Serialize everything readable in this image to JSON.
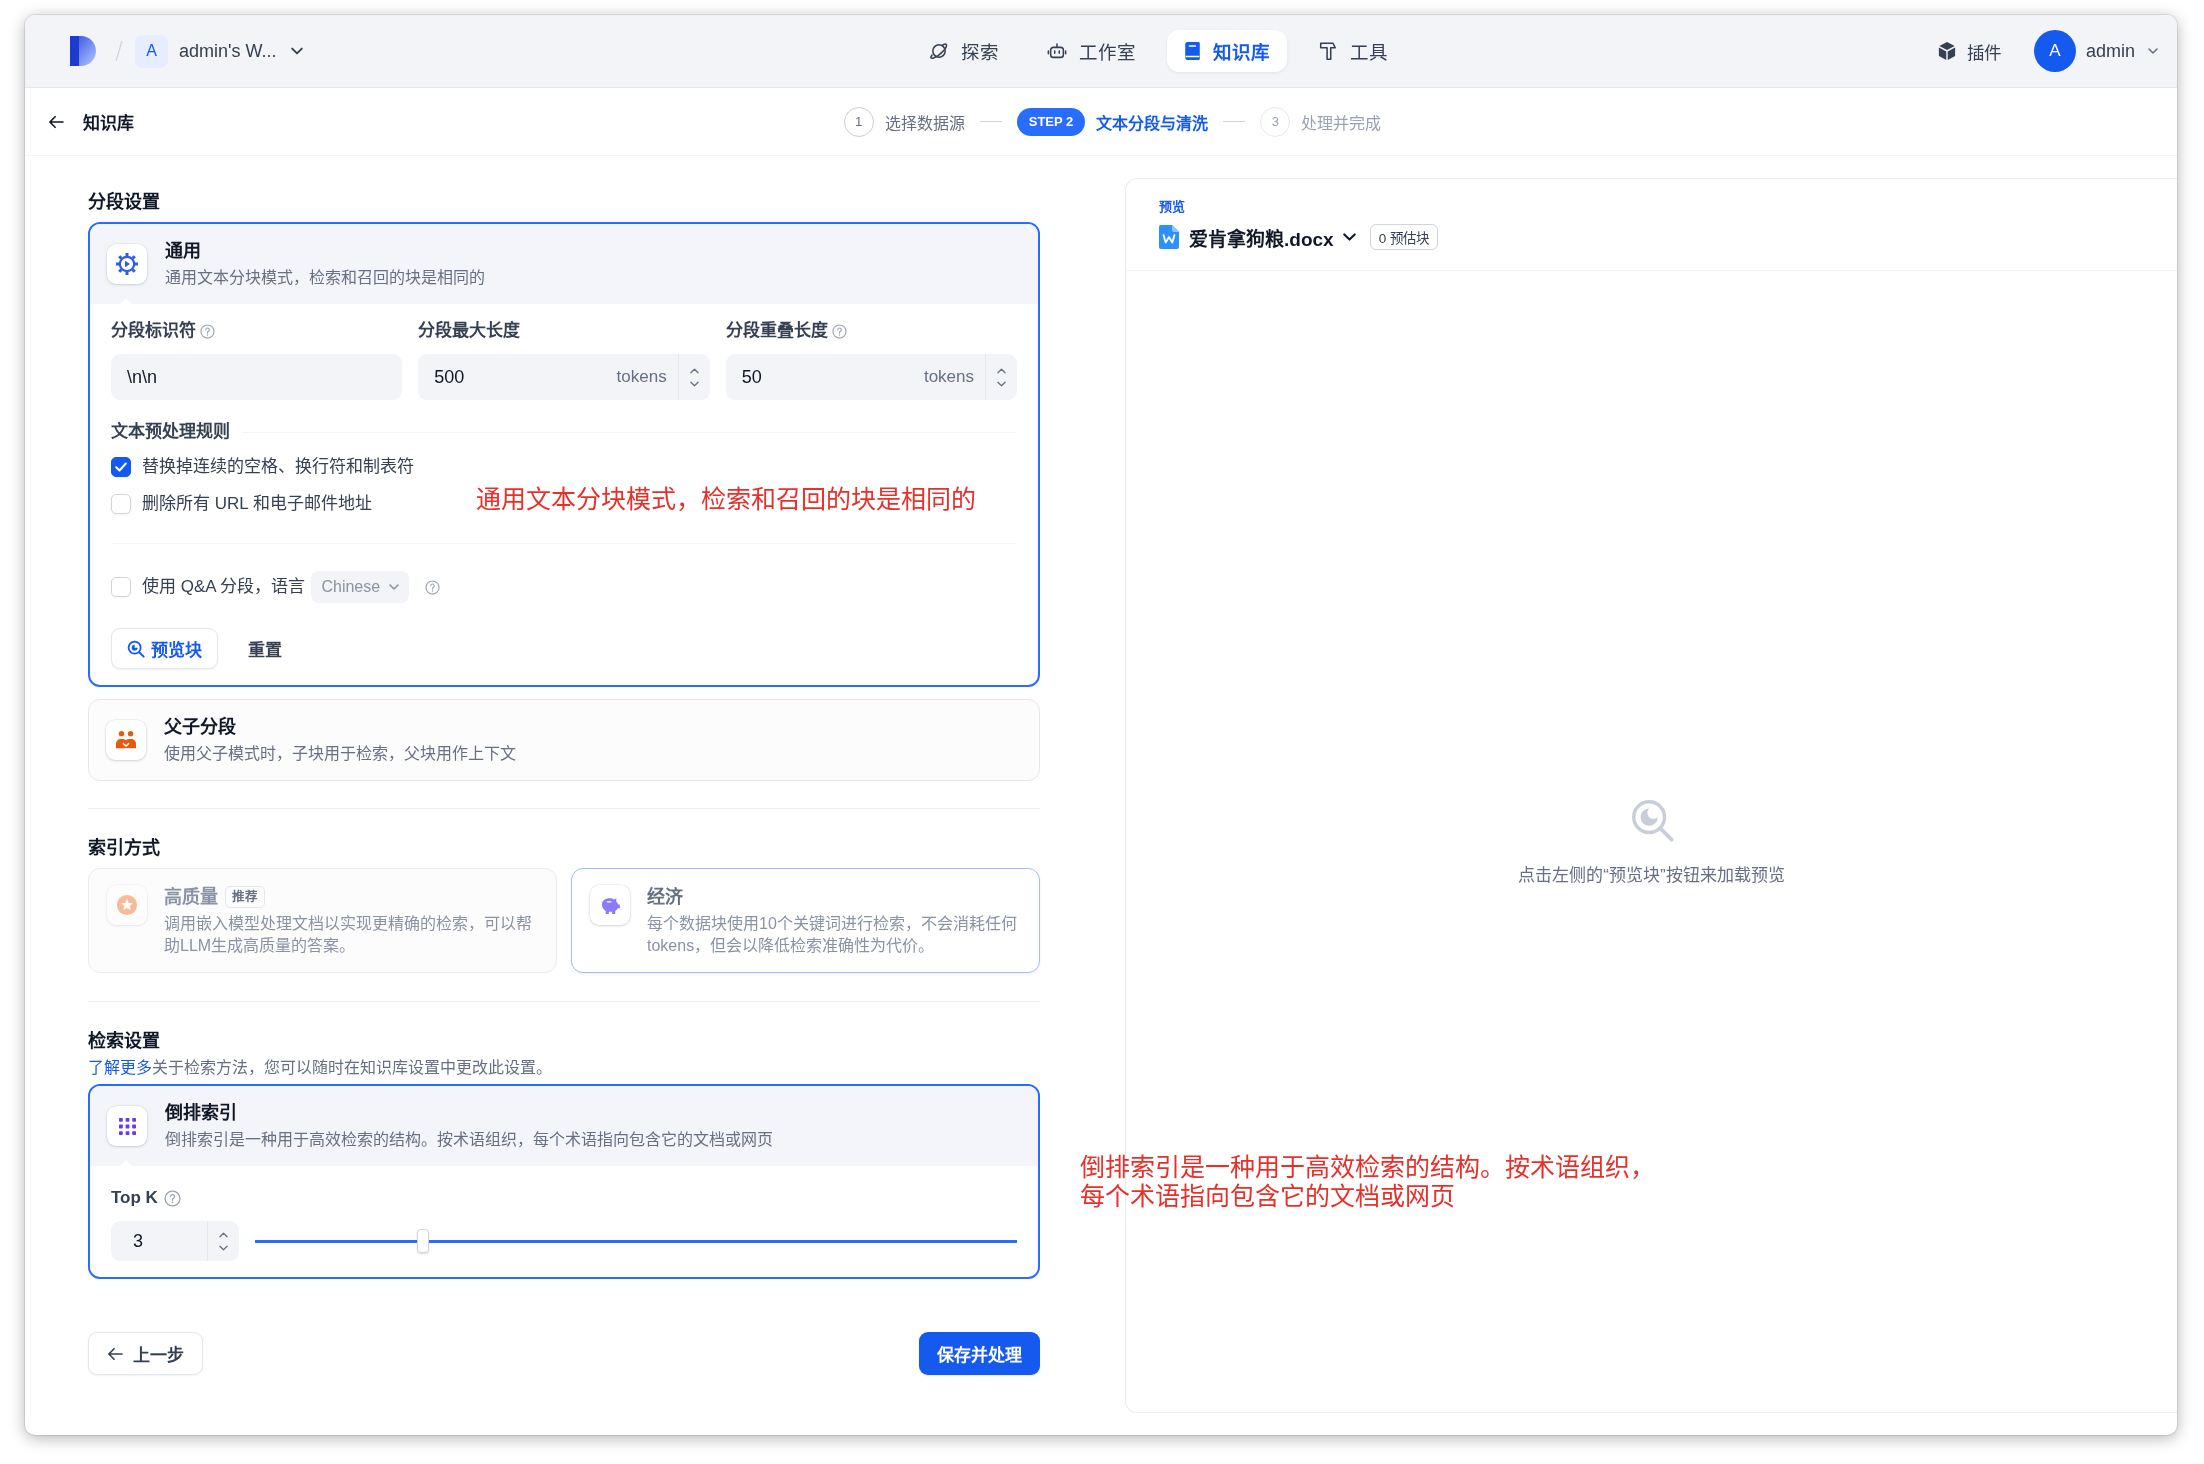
{
  "top_nav": {
    "workspace": {
      "initial": "A",
      "name": "admin's W..."
    },
    "nav_items": [
      {
        "label": "探索",
        "selected": false
      },
      {
        "label": "工作室",
        "selected": false
      },
      {
        "label": "知识库",
        "selected": true
      },
      {
        "label": "工具",
        "selected": false
      }
    ],
    "plugins": {
      "label": "插件"
    },
    "user": {
      "initial": "A",
      "name": "admin"
    }
  },
  "sub_header": {
    "back_label": "知识库",
    "steps": [
      {
        "badge": "1",
        "label": "选择数据源",
        "done": true,
        "selected": false
      },
      {
        "badge": "STEP 2",
        "label": "文本分段与清洗",
        "done": false,
        "selected": true
      },
      {
        "badge": "3",
        "label": "处理并完成",
        "done": false,
        "selected": false
      }
    ]
  },
  "segmentation": {
    "heading": "分段设置",
    "modes": [
      {
        "kind": "general",
        "title": "通用",
        "description": "通用文本分块模式，检索和召回的块是相同的",
        "selected": true,
        "fields": [
          {
            "kind": "text",
            "label": "分段标识符",
            "value": "\\n\\n",
            "help": true
          },
          {
            "kind": "number",
            "label": "分段最大长度",
            "value": "500",
            "unit": "tokens",
            "help": false
          },
          {
            "kind": "number",
            "label": "分段重叠长度",
            "value": "50",
            "unit": "tokens",
            "help": true
          }
        ],
        "rules_heading": "文本预处理规则",
        "rules": [
          {
            "label": "替换掉连续的空格、换行符和制表符",
            "checked": true
          },
          {
            "label": "删除所有 URL 和电子邮件地址",
            "checked": false
          }
        ],
        "qa": {
          "label": "使用 Q&A 分段，语言",
          "checked": false,
          "language": "Chinese",
          "language_disabled": true,
          "help": true
        },
        "actions": [
          {
            "kind": "preview",
            "label": "预览块"
          },
          {
            "kind": "reset",
            "label": "重置"
          }
        ]
      },
      {
        "kind": "parent_child",
        "title": "父子分段",
        "description": "使用父子模式时，子块用于检索，父块用作上下文",
        "selected": false
      }
    ]
  },
  "index_method": {
    "heading": "索引方式",
    "options": [
      {
        "title": "高质量",
        "badge": "推荐",
        "description": "调用嵌入模型处理文档以实现更精确的检索，可以帮助LLM生成高质量的答案。",
        "selected": false,
        "disabled": true
      },
      {
        "title": "经济",
        "description": "每个数据块使用10个关键词进行检索，不会消耗任何tokens，但会以降低检索准确性为代价。",
        "selected": true,
        "disabled": true
      }
    ]
  },
  "retrieval": {
    "heading": "检索设置",
    "link": "了解更多",
    "description": "关于检索方法，您可以随时在知识库设置中更改此设置。",
    "method": {
      "title": "倒排索引",
      "description": "倒排索引是一种用于高效检索的结构。按术语组织，每个术语指向包含它的文档或网页",
      "selected": true
    },
    "top_k": {
      "label": "Top K",
      "help": true,
      "value": "3",
      "level": 0.22
    }
  },
  "footer": {
    "buttons": [
      {
        "kind": "back",
        "label": "上一步"
      },
      {
        "kind": "primary",
        "label": "保存并处理"
      }
    ]
  },
  "preview": {
    "label": "预览",
    "file_name": "爱肯拿狗粮.docx",
    "estimate": "0 预估块",
    "empty_text": "点击左侧的“预览块”按钮来加载预览"
  },
  "annotations": [
    {
      "text": "通用文本分块模式，检索和召回的块是相同的"
    },
    {
      "text": "倒排索引是一种用于高效检索的结构。按术语组织，每个术语指向包含它的文档或网页"
    }
  ]
}
